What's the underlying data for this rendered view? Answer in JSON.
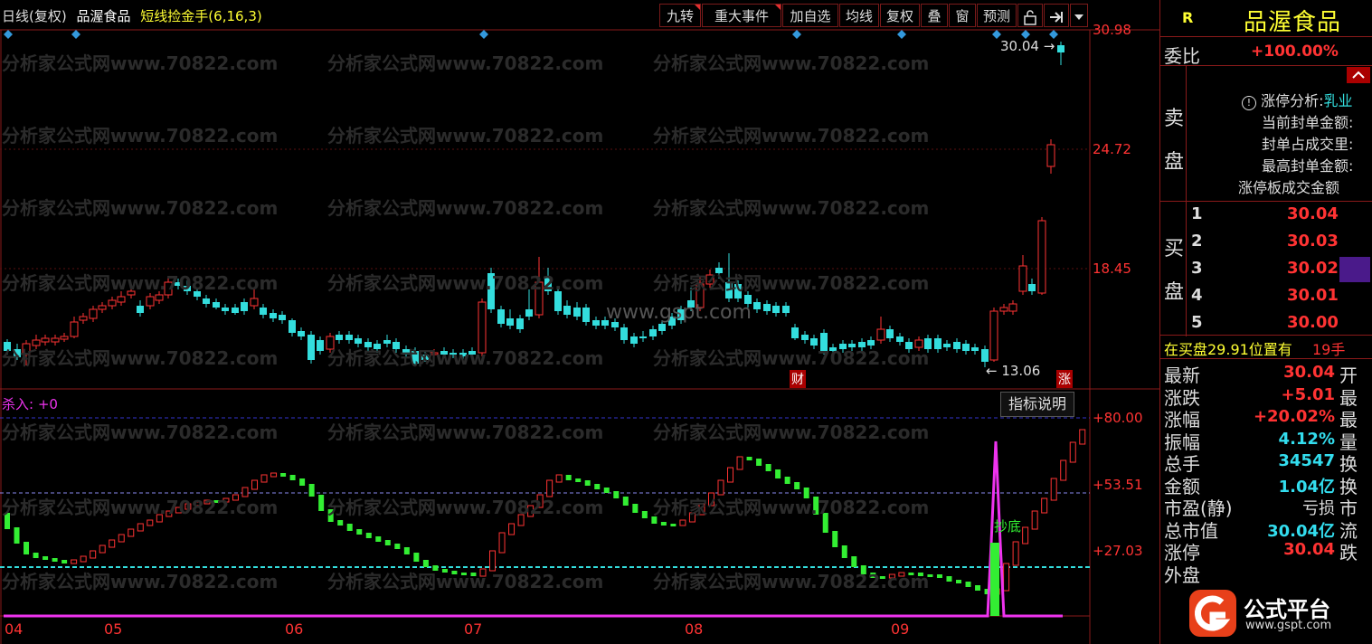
{
  "toolbar": {
    "period": "日线(复权)",
    "stock_name": "品渥食品",
    "indicator": "短线捡金手(6,16,3)",
    "buttons": [
      "九转",
      "重大事件",
      "加自选",
      "均线",
      "复权",
      "叠",
      "窗",
      "预测"
    ],
    "lock_icon": "lock-icon",
    "goto_end_icon": "goto-end-icon",
    "menu_icon": "chevron-down-icon"
  },
  "watermark": "分析家公式网www.70822.com",
  "site_watermark": "www.gspt.com",
  "main_chart": {
    "price_labels": [
      "30.98",
      "24.72",
      "18.45"
    ],
    "high_annotation": "30.04",
    "low_annotation": "13.06",
    "tag_finance": "财",
    "tag_limit_up": "涨"
  },
  "indicator_panel": {
    "title": "杀入: +0",
    "help_button": "指标说明",
    "levels": [
      "+80.00",
      "+53.51",
      "+27.03"
    ],
    "buy_tag": "抄底",
    "months": [
      "04",
      "05",
      "06",
      "07",
      "08",
      "09"
    ]
  },
  "side": {
    "r_badge": "R",
    "name": "品渥食品",
    "weibi_label": "委比",
    "weibi_value": "+100.00%",
    "sell_label": [
      "卖",
      "盘"
    ],
    "limit_analysis": "涨停分析:",
    "limit_industry": "乳业",
    "limit_lines": [
      "当前封单金额:",
      "封单占成交里:",
      "最高封单金额:",
      "涨停板成交金额"
    ],
    "buy_label": [
      "买",
      "盘"
    ],
    "bids": [
      {
        "level": "1",
        "price": "30.04"
      },
      {
        "level": "2",
        "price": "30.03"
      },
      {
        "level": "3",
        "price": "30.02"
      },
      {
        "level": "4",
        "price": "30.01"
      },
      {
        "level": "5",
        "price": "30.00"
      }
    ],
    "buy_position": "在买盘29.91位置有",
    "buy_position_qty": "19手",
    "stats": [
      {
        "label": "最新",
        "value": "30.04",
        "cls": "v-red",
        "right": "开"
      },
      {
        "label": "涨跌",
        "value": "+5.01",
        "cls": "v-red",
        "right": "最"
      },
      {
        "label": "涨幅",
        "value": "+20.02%",
        "cls": "v-red",
        "right": "最"
      },
      {
        "label": "振幅",
        "value": "4.12%",
        "cls": "v-cyan",
        "right": "量"
      },
      {
        "label": "总手",
        "value": "34547",
        "cls": "v-cyan",
        "right": "换"
      },
      {
        "label": "金额",
        "value": "1.04亿",
        "cls": "v-cyan",
        "right": "换"
      },
      {
        "label": "市盈(静)",
        "value": "亏损",
        "cls": "v-white",
        "right": "市"
      },
      {
        "label": "总市值",
        "value": "30.04亿",
        "cls": "v-cyan",
        "right": "流"
      },
      {
        "label": "涨停",
        "value": "30.04",
        "cls": "v-red",
        "right": "跌"
      },
      {
        "label": "外盘",
        "value": "",
        "cls": "v-red",
        "right": ""
      }
    ],
    "logo_text": "公式平台",
    "logo_url": "www.gspt.com"
  },
  "colors": {
    "up": "#ff3333",
    "down": "#33dddd",
    "green": "#33ee33",
    "magenta": "#ee33ee",
    "cyan_line": "#33dddd"
  }
}
